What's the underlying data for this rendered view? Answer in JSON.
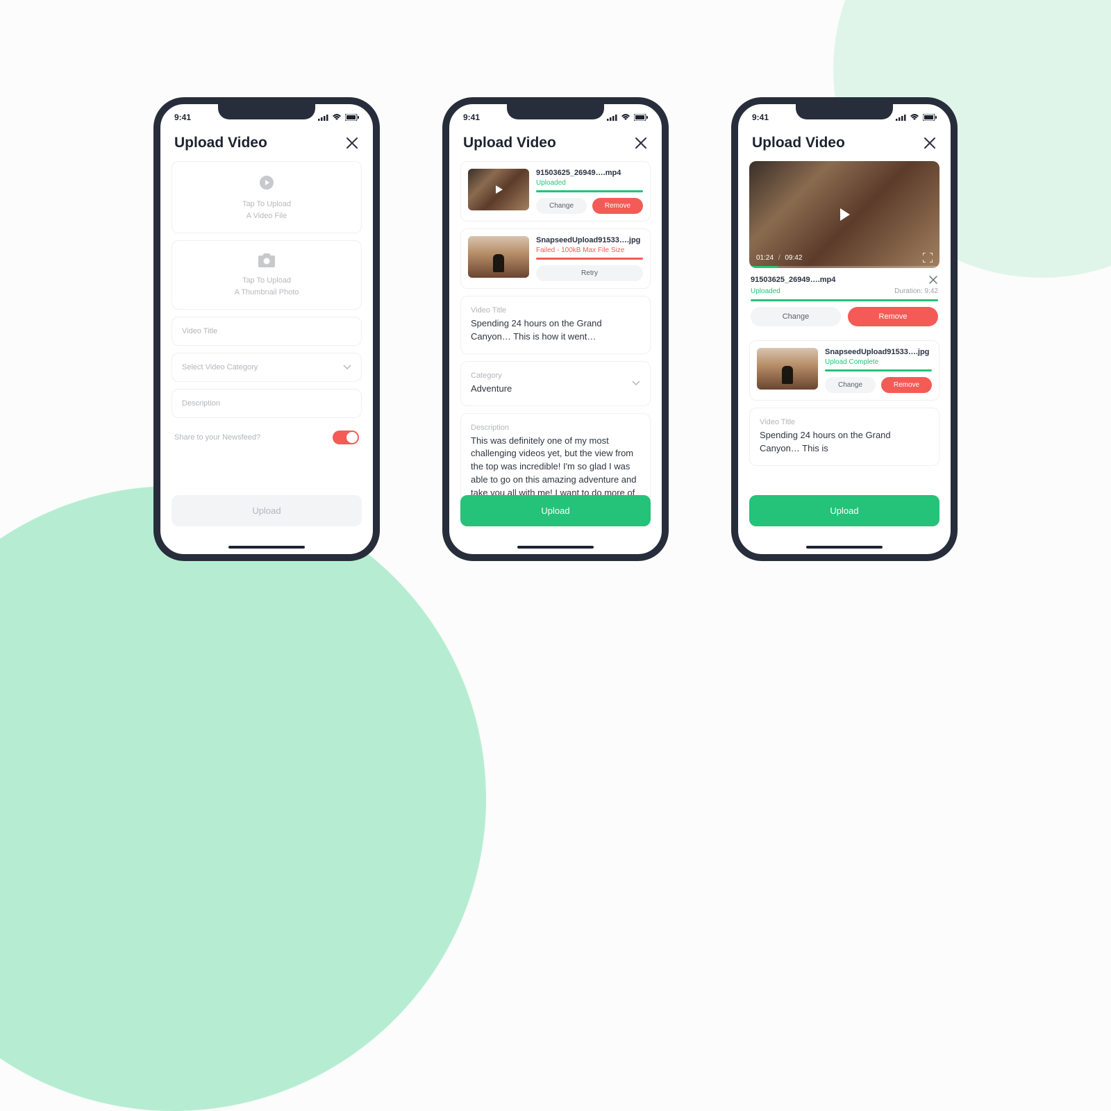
{
  "statusBar": {
    "time": "9:41"
  },
  "screen1": {
    "title": "Upload Video",
    "uploadVideo": {
      "line1": "Tap To Upload",
      "line2": "A Video File"
    },
    "uploadThumb": {
      "line1": "Tap To Upload",
      "line2": "A Thumbnail Photo"
    },
    "videoTitlePlaceholder": "Video Title",
    "categoryPlaceholder": "Select Video Category",
    "descriptionPlaceholder": "Description",
    "shareLabel": "Share to your Newsfeed?",
    "uploadBtn": "Upload"
  },
  "screen2": {
    "title": "Upload Video",
    "video": {
      "name": "91503625_26949….mp4",
      "status": "Uploaded",
      "changeBtn": "Change",
      "removeBtn": "Remove"
    },
    "thumb": {
      "name": "SnapseedUpload91533….jpg",
      "status": "Failed - 100kB Max File Size",
      "retryBtn": "Retry"
    },
    "titleLabel": "Video Title",
    "titleValue": "Spending 24 hours on the Grand Canyon… This is how it went…",
    "categoryLabel": "Category",
    "categoryValue": "Adventure",
    "descLabel": "Description",
    "descValue": "This was definitely one of my most challenging videos yet, but the view from the top was incredible! I'm so glad I was able to go on this amazing adventure and take you all with me! I want to do more of these in the future, so make",
    "uploadBtn": "Upload"
  },
  "screen3": {
    "title": "Upload Video",
    "playerTime": {
      "current": "01:24",
      "sep": "/",
      "total": "09:42"
    },
    "video": {
      "name": "91503625_26949….mp4",
      "status": "Uploaded",
      "duration": "Duration: 9:42",
      "changeBtn": "Change",
      "removeBtn": "Remove"
    },
    "thumb": {
      "name": "SnapseedUpload91533….jpg",
      "status": "Upload Complete",
      "changeBtn": "Change",
      "removeBtn": "Remove"
    },
    "titleLabel": "Video Title",
    "titleValue": "Spending 24 hours on the Grand Canyon… This is",
    "uploadBtn": "Upload"
  }
}
